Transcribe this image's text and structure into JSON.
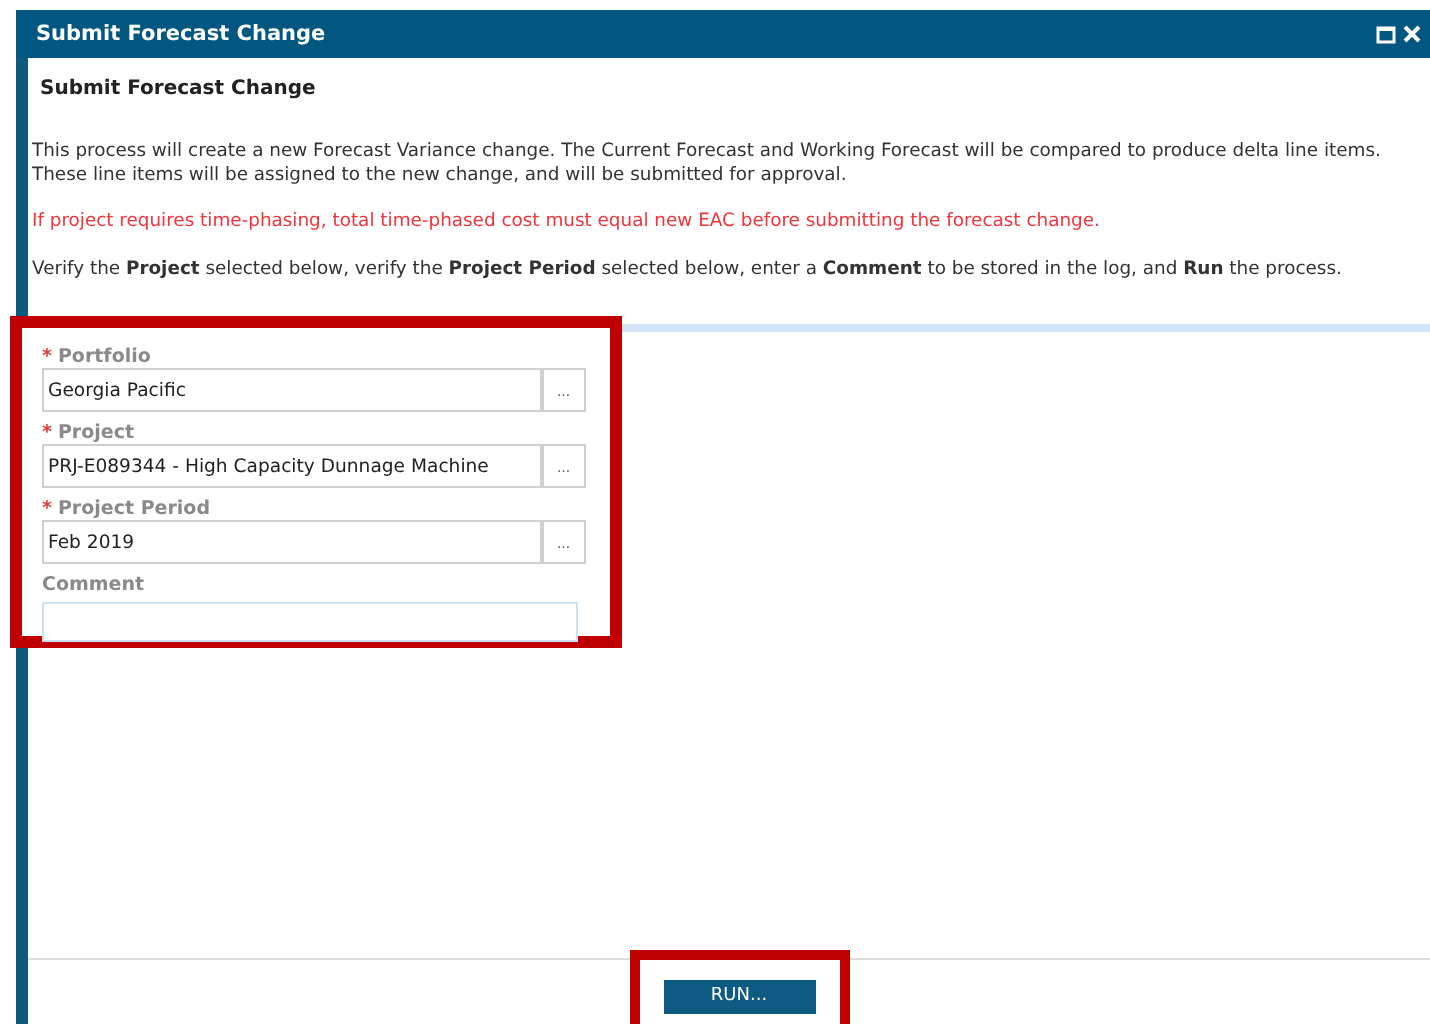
{
  "window": {
    "title": "Submit Forecast Change"
  },
  "heading": "Submit Forecast Change",
  "description": "This process will create a new Forecast Variance change. The Current Forecast and Working Forecast will be compared to produce delta line items. These line items will be assigned to the new change, and will be submitted for approval.",
  "warning": "If project requires time-phasing, total time-phased cost must equal new EAC before submitting the forecast change.",
  "instructions": "Verify the **Project** selected below, verify the **Project Period** selected below, enter a **Comment** to be stored in the log, and **Run** the process.",
  "fields": [
    {
      "kind": "lookup",
      "required_mark": "*",
      "label": "Portfolio",
      "value": "Georgia Pacific",
      "browse_label": "..."
    },
    {
      "kind": "lookup",
      "required_mark": "*",
      "label": "Project",
      "value": "PRJ-E089344 - High Capacity Dunnage Machine",
      "browse_label": "..."
    },
    {
      "kind": "lookup",
      "required_mark": "*",
      "label": "Project Period",
      "value": "Feb 2019",
      "browse_label": "..."
    },
    {
      "kind": "text",
      "label": "Comment"
    }
  ],
  "run_button": "RUN..."
}
